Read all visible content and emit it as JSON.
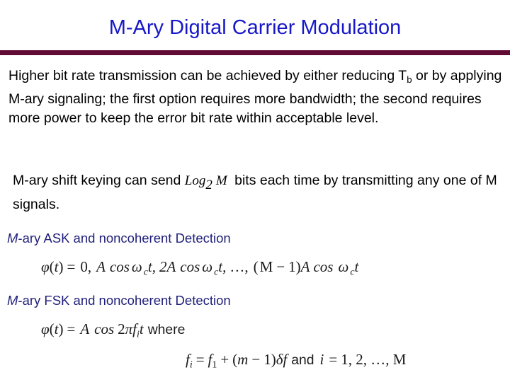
{
  "slide": {
    "title": "M-Ary Digital Carrier Modulation",
    "title_color": "#1818c8",
    "rule_color": "#5f0b33",
    "background_color": "#ffffff"
  },
  "body": {
    "paragraph_1": {
      "line_1_a": "Higher bit rate transmission can be achieved by either reducing ",
      "line_1_t": "T",
      "line_1_t_sub": "b",
      "line_1_b": " or by applying M-ary signaling; the first option requires more bandwidth; the second requires more power to keep the error bit rate within acceptable level."
    },
    "paragraph_2": {
      "part_a": "M-ary shift keying can send ",
      "math_log": "Log",
      "math_log_sub": "2",
      "math_m": "M",
      "part_b": " bits each time by transmitting any one of M signals."
    }
  },
  "sections": {
    "ask_heading_italic": "M",
    "ask_heading_rest": "-ary ASK and noncoherent Detection",
    "fsk_heading_italic": "M",
    "fsk_heading_rest": "-ary FSK and noncoherent Detection",
    "heading_color": "#1f1f7a"
  },
  "equations": {
    "eq1": {
      "phi": "φ",
      "paren_open": "(",
      "t": "t",
      "paren_close": ")",
      "equals": "=",
      "zero": "0,",
      "A1": "A",
      "cos1": "cos",
      "omega1": "ω",
      "omega1_sub": "c",
      "t1": "t,",
      "two_A": "2A",
      "cos2": "cos",
      "omega2": "ω",
      "omega2_sub": "c",
      "t2": "t,",
      "ellipsis": "…,",
      "group_open": "(",
      "M": "M",
      "minus": "−",
      "one": "1",
      "group_close": ")",
      "A2": "A",
      "cos3": "cos",
      "omega3": "ω",
      "omega3_sub": "c",
      "t3": "t",
      "full_text": "φ(t) = 0, A cos ωct, 2A cos ωct, …, (M − 1)A cos ωct"
    },
    "eq2": {
      "phi": "φ",
      "paren_open": "(",
      "t": "t",
      "paren_close": ")",
      "equals": "=",
      "A": "A",
      "cos": "cos",
      "two": "2",
      "pi": "π",
      "f": "f",
      "f_sub": "i",
      "t_end": "t",
      "where": "where",
      "full_text": "φ(t) = A cos 2πfit    where"
    },
    "eq3": {
      "f1": "f",
      "f1_sub": "i",
      "equals": "=",
      "f2": "f",
      "f2_sub": "1",
      "plus": "+",
      "paren_open": "(",
      "m": "m",
      "minus": "−",
      "one": "1",
      "paren_close": ")",
      "delta": "δ",
      "f3": "f",
      "and": "and",
      "i": "i",
      "equals2": "=",
      "list": "1, 2, …, M",
      "full_text": "fi = f1 + (m − 1)δf  and  i = 1, 2, …, M"
    }
  }
}
